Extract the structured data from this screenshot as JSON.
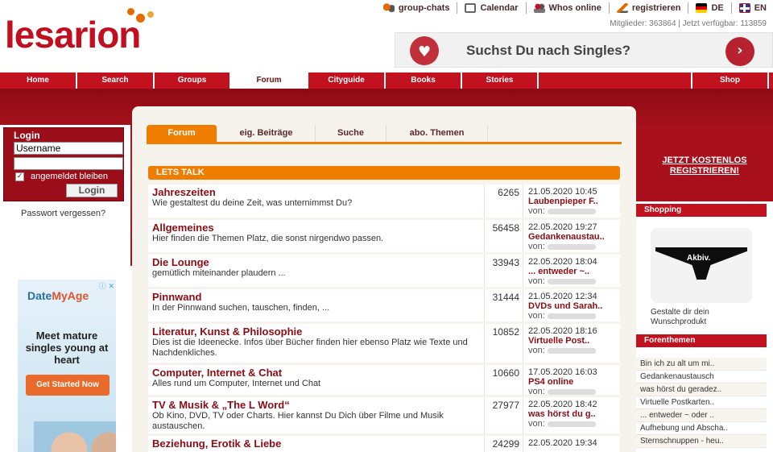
{
  "brand": {
    "logo_text": "lesarion",
    "color": "#c10f1f"
  },
  "topnav": [
    {
      "icon": "chat-bubbles-icon",
      "label": "group-chats"
    },
    {
      "icon": "calendar-icon",
      "label": "Calendar"
    },
    {
      "icon": "users-icon",
      "label": "Whos online"
    },
    {
      "icon": "pen-icon",
      "label": "registrieren"
    },
    {
      "icon": "german-flag-icon",
      "label": "DE"
    },
    {
      "icon": "uk-flag-icon",
      "label": "EN"
    }
  ],
  "members_line": "Mitglieder: 363864 | Jetzt verfügbar: 113859",
  "ad_top": {
    "text": "Suchst Du nach Singles?",
    "arrow": "›"
  },
  "mainnav": [
    {
      "label": "Home"
    },
    {
      "label": "Search"
    },
    {
      "label": "Groups"
    },
    {
      "label": "Forum"
    },
    {
      "label": "Cityguide"
    },
    {
      "label": "Books"
    },
    {
      "label": "Stories"
    },
    {
      "label": ""
    },
    {
      "label": "Shop"
    }
  ],
  "login": {
    "title": "Login",
    "username_value": "Username",
    "password_value": "",
    "remember_label": "angemeldet bleiben",
    "button": "Login",
    "forgot": "Passwort vergessen?"
  },
  "ad_left": {
    "brand_a": "Date",
    "brand_b": "MyAge",
    "message": "Meet mature singles young at heart",
    "cta": "Get Started Now"
  },
  "tabs": [
    {
      "label": "Forum"
    },
    {
      "label": "eig. Beiträge"
    },
    {
      "label": "Suche"
    },
    {
      "label": "abo. Themen"
    }
  ],
  "section_title": "LETS TALK",
  "forums": [
    {
      "title": "Jahreszeiten",
      "desc": "Wie gestaltest du deine Zeit, was unternimmst Du?",
      "count": "6265",
      "date": "21.05.2020 10:45",
      "last": "Laubenpieper F..",
      "by": "von:"
    },
    {
      "title": "Allgemeines",
      "desc": "Hier finden die Themen Platz, die sonst nirgendwo passen.",
      "count": "56458",
      "date": "22.05.2020 19:27",
      "last": "Gedankenaustau..",
      "by": "von:"
    },
    {
      "title": "Die Lounge",
      "desc": "gemütlich miteinander plaudern ...",
      "count": "33943",
      "date": "22.05.2020 18:04",
      "last": "... entweder ~..",
      "by": "von:"
    },
    {
      "title": "Pinnwand",
      "desc": "In der Pinnwand suchen, tauschen, finden, ...",
      "count": "31444",
      "date": "21.05.2020 12:34",
      "last": "DVDs und Sarah..",
      "by": "von:"
    },
    {
      "title": "Literatur, Kunst & Philosophie",
      "desc": "Dies ist die Ideenecke. Infos über Bücher finden hier ebenso Platz wie Texte und Nachdenkliches.",
      "count": "10852",
      "date": "22.05.2020 18:16",
      "last": "Virtuelle Post..",
      "by": "von:"
    },
    {
      "title": "Computer, Internet & Chat",
      "desc": "Alles rund um Computer, Internet und Chat",
      "count": "10660",
      "date": "17.05.2020 16:03",
      "last": "PS4 online",
      "by": "von:"
    },
    {
      "title": "TV & Musik & „The L Word“",
      "desc": "Ob Kino, DVD, TV oder Charts. Hier kannst Du Dich über Filme und Musik austauschen.",
      "count": "27977",
      "date": "22.05.2020 18:42",
      "last": "was hörst du g..",
      "by": "von:"
    },
    {
      "title": "Beziehung, Erotik & Liebe",
      "desc": "",
      "count": "24299",
      "date": "22.05.2020 19:34",
      "last": "",
      "by": ""
    }
  ],
  "register": "JETZT KOSTENLOS REGISTRIEREN!",
  "shopping": {
    "title": "Shopping",
    "product_text": "Akbiv.",
    "caption": "Gestalte dir dein Wunschprodukt"
  },
  "forenthemen": {
    "title": "Forenthemen",
    "items": [
      "Bin ich zu alt um mi..",
      "Gedankenaustausch",
      "was hörst du geradez..",
      "Virtuelle Postkarten..",
      "... entweder ~ oder ..",
      "Aufhebung und Abscha..",
      "Sternschnuppen - heu.."
    ]
  }
}
